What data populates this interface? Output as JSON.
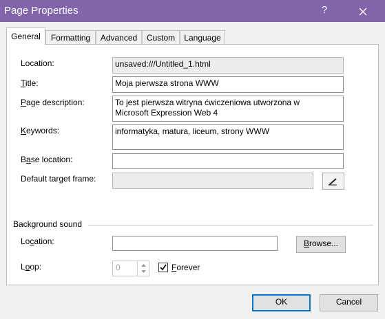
{
  "window": {
    "title": "Page Properties",
    "help_label": "?",
    "close_icon": "close-icon"
  },
  "tabs": [
    {
      "label": "General",
      "active": true
    },
    {
      "label": "Formatting",
      "active": false
    },
    {
      "label": "Advanced",
      "active": false
    },
    {
      "label": "Custom",
      "active": false
    },
    {
      "label": "Language",
      "active": false
    }
  ],
  "general": {
    "location": {
      "label_pre": "",
      "label_key": "",
      "label_post": "Location:",
      "value": "unsaved:///Untitled_1.html"
    },
    "title": {
      "label_key": "T",
      "label_post": "itle:",
      "value": "Moja pierwsza strona WWW"
    },
    "description": {
      "label_key": "P",
      "label_post": "age description:",
      "value_line1": "To jest pierwsza witryna ćwiczeniowa utworzona w",
      "value_line2": "Microsoft Expression Web 4"
    },
    "keywords": {
      "label_key": "K",
      "label_post": "eywords:",
      "value": "informatyka, matura, liceum, strony WWW"
    },
    "base_location": {
      "label_pre": "B",
      "label_key": "a",
      "label_post": "se location:",
      "value": ""
    },
    "target_frame": {
      "label": "Default target frame:",
      "value": ""
    }
  },
  "background_sound": {
    "section_label": "Background sound",
    "location_label_pre": "Lo",
    "location_label_key": "c",
    "location_label_post": "ation:",
    "location_value": "",
    "browse_label_pre": "",
    "browse_label_key": "B",
    "browse_label_post": "rowse...",
    "loop_label_pre": "L",
    "loop_label_key": "o",
    "loop_label_post": "op:",
    "loop_value": "0",
    "forever_label_key": "F",
    "forever_label_post": "orever",
    "forever_checked": true
  },
  "buttons": {
    "ok": "OK",
    "cancel": "Cancel"
  },
  "colors": {
    "titlebar": "#8164a9",
    "accent": "#0078d7"
  }
}
